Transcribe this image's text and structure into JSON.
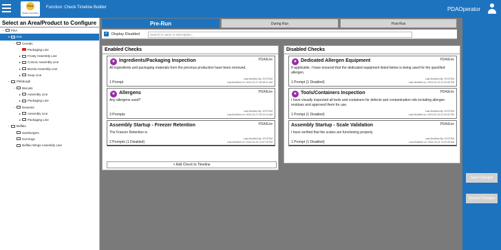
{
  "header": {
    "logo_text": "Stellar Consulting",
    "function_title": "Function: Check Timeline Builder",
    "user_name": "PDAOperator"
  },
  "sidebar": {
    "title": "Select an Area/Product to Configure",
    "tree": [
      {
        "label": "PDA",
        "toggle": "−",
        "level": 0,
        "selected": false,
        "icon": "folder"
      },
      {
        "label": "Erie",
        "toggle": "▾",
        "level": 1,
        "selected": true,
        "icon": "folder"
      },
      {
        "label": "Cereals",
        "toggle": "−",
        "level": 2,
        "selected": false,
        "icon": "folder"
      },
      {
        "label": "Packaging Line",
        "toggle": "",
        "level": 3,
        "selected": false,
        "icon": "flag"
      },
      {
        "label": "Frosty Assembly Line",
        "toggle": "▸",
        "level": 3,
        "selected": false,
        "icon": "folder"
      },
      {
        "label": "Cosmic Assembly Line",
        "toggle": "▸",
        "level": 3,
        "selected": false,
        "icon": "folder"
      },
      {
        "label": "Burrito Assembly Line",
        "toggle": "▸",
        "level": 3,
        "selected": false,
        "icon": "folder"
      },
      {
        "label": "Soup Line",
        "toggle": "▸",
        "level": 3,
        "selected": false,
        "icon": "folder"
      },
      {
        "label": "Pittsburgh",
        "toggle": "−",
        "level": 1,
        "selected": false,
        "icon": "folder"
      },
      {
        "label": "Biscuits",
        "toggle": "−",
        "level": 2,
        "selected": false,
        "icon": "folder"
      },
      {
        "label": "Assembly Line",
        "toggle": "▸",
        "level": 3,
        "selected": false,
        "icon": "folder"
      },
      {
        "label": "Packaging Line",
        "toggle": "▸",
        "level": 3,
        "selected": false,
        "icon": "folder"
      },
      {
        "label": "Desserts",
        "toggle": "−",
        "level": 2,
        "selected": false,
        "icon": "folder"
      },
      {
        "label": "Assembly Line",
        "toggle": "▸",
        "level": 3,
        "selected": false,
        "icon": "folder"
      },
      {
        "label": "Packaging Line",
        "toggle": "▸",
        "level": 3,
        "selected": false,
        "icon": "folder"
      },
      {
        "label": "Buffalo",
        "toggle": "−",
        "level": 1,
        "selected": false,
        "icon": "folder"
      },
      {
        "label": "Hamburgers",
        "toggle": "",
        "level": 2,
        "selected": false,
        "icon": "folder"
      },
      {
        "label": "Hot Dogs",
        "toggle": "",
        "level": 2,
        "selected": false,
        "icon": "folder"
      },
      {
        "label": "Buffalo Wings Assembly Line",
        "toggle": "",
        "level": 2,
        "selected": false,
        "icon": "folder"
      }
    ]
  },
  "tabs": [
    {
      "label": "Pre-Run",
      "active": true
    },
    {
      "label": "During Run",
      "active": false
    },
    {
      "label": "Post-Run",
      "active": false
    }
  ],
  "filter": {
    "checkbox_label": "Display Disabled",
    "search_placeholder": "Search in name or description..."
  },
  "enabled": {
    "title": "Enabled Checks",
    "add_label": "Add Check to Timeline",
    "cards": [
      {
        "title": "Ingredients/Packaging Inspection",
        "location": "PDA/Erie",
        "description": "All ingredients and packaging materials from the previous production have been removed.",
        "prompts": "1 Prompt",
        "modified_by": "Last Modified By: SYSTEM",
        "modified_on": "Last Modified on: 2024-03-27 09:08:31 AM",
        "badge": true
      },
      {
        "title": "Allergens",
        "location": "PDA/Erie",
        "description": "Any allergens used?",
        "prompts": "3 Prompts",
        "modified_by": "Last Modified By: SYSTEM",
        "modified_on": "Last Modified on: 2024-03-27 09:22:14 AM",
        "badge": true
      },
      {
        "title": "Assembly Startup - Freezer Retention",
        "location": "PDA/Erie",
        "description": "The Freezer Retention is",
        "prompts": "2 Prompts  (1 Disabled)",
        "modified_by": "Last Modified By: SYSTEM",
        "modified_on": "Last Modified on: 2024-03-29 11:57:18 PM",
        "badge": false
      }
    ]
  },
  "disabled": {
    "title": "Disabled Checks",
    "cards": [
      {
        "title": "Dedicated Allergen Equipment",
        "location": "PDA/Erie",
        "description": "If applicable, I have ensured that the dedicated equipment listed below is being used for the specified allergen.",
        "prompts": "1 Prompt  (1 Disabled)",
        "modified_by": "Last Modified By: SYSTEM",
        "modified_on": "Last Modified on: 2024-03-13 01:32:06 PM",
        "badge": true
      },
      {
        "title": "Tools/Containers Inspection",
        "location": "PDA/Erie",
        "description": "I have visually inspected all tools and containers for defects and contamination risk including allergen residues and approved them for use.",
        "prompts": "1 Prompt  (1 Disabled)",
        "modified_by": "Last Modified By: SYSTEM",
        "modified_on": "Last Modified on: 2024-03-13 01:29:42 PM",
        "badge": true
      },
      {
        "title": "Assembly Startup - Scale Validation",
        "location": "PDA/Erie",
        "description": "I have verified that the scales are functioning properly.",
        "prompts": "1 Prompt  (1 Disabled)",
        "modified_by": "Last Modified By: SYSTEM",
        "modified_on": "Last Modified on: 2024-03-21 11:03:28 AM",
        "badge": false
      }
    ]
  },
  "actions": {
    "save_label": "Save Changes",
    "discard_label": "Discard Changes"
  },
  "colors": {
    "primary": "#1e73be",
    "badge": "#9a2aa6",
    "flag": "#d62020",
    "background": "#7a7a7a"
  }
}
